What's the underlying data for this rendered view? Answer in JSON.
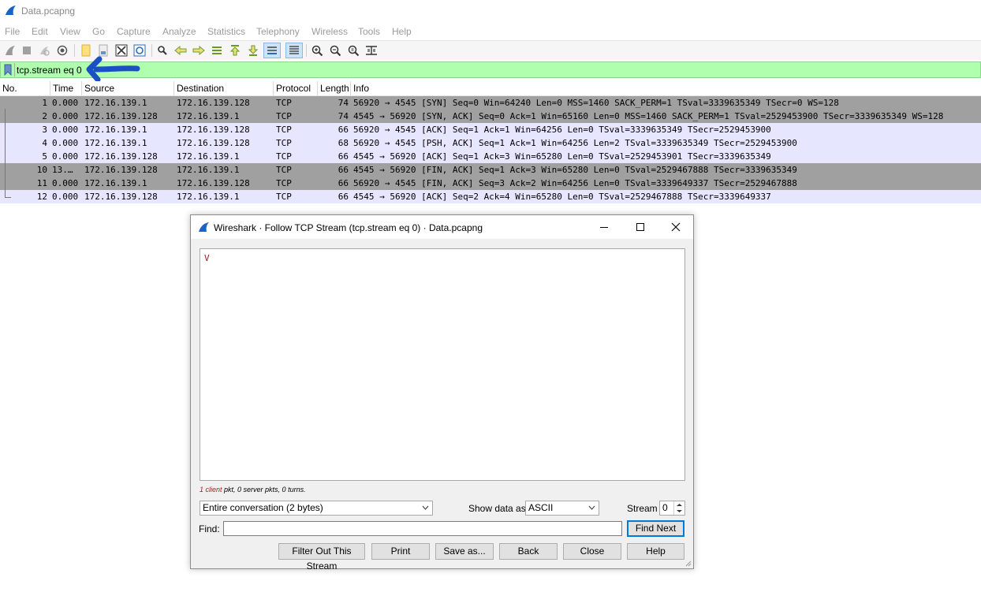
{
  "window": {
    "title": "Data.pcapng"
  },
  "menu": [
    "File",
    "Edit",
    "View",
    "Go",
    "Capture",
    "Analyze",
    "Statistics",
    "Telephony",
    "Wireless",
    "Tools",
    "Help"
  ],
  "toolbar": {
    "icons": [
      "shark-fin-start-icon",
      "stop-capture-icon",
      "restart-capture-icon",
      "capture-options-icon",
      "open-file-icon",
      "save-file-icon",
      "close-file-icon",
      "reload-file-icon",
      "find-packet-icon",
      "go-back-icon",
      "go-forward-icon",
      "go-to-packet-icon",
      "go-first-icon",
      "go-last-icon",
      "autoscroll-icon",
      "colorize-icon",
      "zoom-in-icon",
      "zoom-out-icon",
      "normal-size-icon",
      "resize-columns-icon"
    ]
  },
  "filter": {
    "value": "tcp.stream eq 0",
    "accent": "#afffaf"
  },
  "packet_list": {
    "columns": [
      "No.",
      "Time",
      "Source",
      "Destination",
      "Protocol",
      "Length",
      "Info"
    ],
    "rows": [
      {
        "no": "1",
        "time": "0.000",
        "src": "172.16.139.1",
        "dst": "172.16.139.128",
        "proto": "TCP",
        "len": "74",
        "info": "56920 → 4545 [SYN] Seq=0 Win=64240 Len=0 MSS=1460 SACK_PERM=1 TSval=3339635349 TSecr=0 WS=128",
        "style": "dark"
      },
      {
        "no": "2",
        "time": "0.000",
        "src": "172.16.139.128",
        "dst": "172.16.139.1",
        "proto": "TCP",
        "len": "74",
        "info": "4545 → 56920 [SYN, ACK] Seq=0 Ack=1 Win=65160 Len=0 MSS=1460 SACK_PERM=1 TSval=2529453900 TSecr=3339635349 WS=128",
        "style": "dark"
      },
      {
        "no": "3",
        "time": "0.000",
        "src": "172.16.139.1",
        "dst": "172.16.139.128",
        "proto": "TCP",
        "len": "66",
        "info": "56920 → 4545 [ACK] Seq=1 Ack=1 Win=64256 Len=0 TSval=3339635349 TSecr=2529453900",
        "style": "light"
      },
      {
        "no": "4",
        "time": "0.000",
        "src": "172.16.139.1",
        "dst": "172.16.139.128",
        "proto": "TCP",
        "len": "68",
        "info": "56920 → 4545 [PSH, ACK] Seq=1 Ack=1 Win=64256 Len=2 TSval=3339635349 TSecr=2529453900",
        "style": "light"
      },
      {
        "no": "5",
        "time": "0.000",
        "src": "172.16.139.128",
        "dst": "172.16.139.1",
        "proto": "TCP",
        "len": "66",
        "info": "4545 → 56920 [ACK] Seq=1 Ack=3 Win=65280 Len=0 TSval=2529453901 TSecr=3339635349",
        "style": "light"
      },
      {
        "no": "10",
        "time": "13.…",
        "src": "172.16.139.128",
        "dst": "172.16.139.1",
        "proto": "TCP",
        "len": "66",
        "info": "4545 → 56920 [FIN, ACK] Seq=1 Ack=3 Win=65280 Len=0 TSval=2529467888 TSecr=3339635349",
        "style": "dark"
      },
      {
        "no": "11",
        "time": "0.000",
        "src": "172.16.139.1",
        "dst": "172.16.139.128",
        "proto": "TCP",
        "len": "66",
        "info": "56920 → 4545 [FIN, ACK] Seq=3 Ack=2 Win=64256 Len=0 TSval=3339649337 TSecr=2529467888",
        "style": "dark"
      },
      {
        "no": "12",
        "time": "0.000",
        "src": "172.16.139.128",
        "dst": "172.16.139.1",
        "proto": "TCP",
        "len": "66",
        "info": "4545 → 56920 [ACK] Seq=2 Ack=4 Win=65280 Len=0 TSval=2529467888 TSecr=3339649337",
        "style": "light"
      }
    ]
  },
  "dialog": {
    "title": "Wireshark · Follow TCP Stream (tcp.stream eq 0) · Data.pcapng",
    "stream_content": "V",
    "stats": {
      "client": "1 client",
      "rest": " pkt, 0 server pkts, 0 turns."
    },
    "conversation_select": "Entire conversation (2 bytes)",
    "show_data_label": "Show data as",
    "show_data_value": "ASCII",
    "stream_label": "Stream",
    "stream_value": "0",
    "find_label": "Find:",
    "find_value": "",
    "buttons": {
      "find_next": "Find Next",
      "filter_out": "Filter Out This Stream",
      "print": "Print",
      "save_as": "Save as...",
      "back": "Back",
      "close": "Close",
      "help": "Help"
    }
  }
}
